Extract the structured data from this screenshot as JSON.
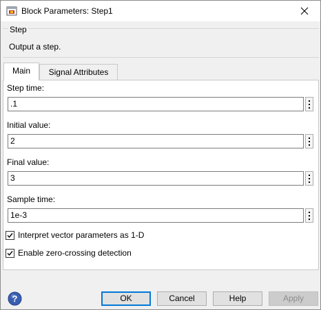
{
  "window": {
    "title": "Block Parameters: Step1",
    "icon": "simulink-block-icon"
  },
  "block": {
    "name": "Step",
    "description": "Output a step."
  },
  "tabs": [
    {
      "label": "Main",
      "active": true
    },
    {
      "label": "Signal Attributes",
      "active": false
    }
  ],
  "fields": {
    "step_time": {
      "label": "Step time:",
      "value": ".1"
    },
    "initial_value": {
      "label": "Initial value:",
      "value": "2"
    },
    "final_value": {
      "label": "Final value:",
      "value": "3"
    },
    "sample_time": {
      "label": "Sample time:",
      "value": "1e-3"
    }
  },
  "checkboxes": {
    "interpret_vector": {
      "label": "Interpret vector parameters as 1-D",
      "checked": true
    },
    "zero_crossing": {
      "label": "Enable zero-crossing detection",
      "checked": true
    }
  },
  "buttons": {
    "ok": "OK",
    "cancel": "Cancel",
    "help": "Help",
    "apply": "Apply"
  },
  "colors": {
    "default_button_border": "#0078d7",
    "help_icon": "#3a5fb0"
  }
}
